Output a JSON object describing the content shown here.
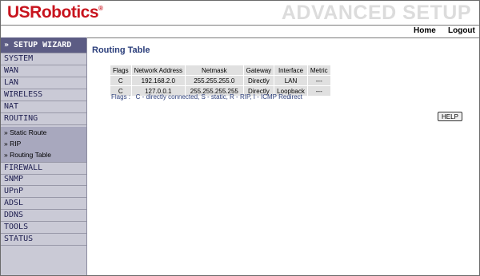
{
  "brand": {
    "logo_text": "USRobotics",
    "reg_mark": "®",
    "banner": "ADVANCED SETUP"
  },
  "topnav": {
    "home": "Home",
    "logout": "Logout"
  },
  "sidebar": {
    "wizard": "» SETUP WIZARD",
    "items": [
      "SYSTEM",
      "WAN",
      "LAN",
      "WIRELESS",
      "NAT",
      "ROUTING"
    ],
    "routing_sub": [
      "» Static Route",
      "» RIP",
      "» Routing Table"
    ],
    "items_after": [
      "FIREWALL",
      "SNMP",
      "UPnP",
      "ADSL",
      "DDNS",
      "TOOLS",
      "STATUS"
    ]
  },
  "main": {
    "title": "Routing Table",
    "table": {
      "headers": [
        "Flags",
        "Network Address",
        "Netmask",
        "Gateway",
        "Interface",
        "Metric"
      ],
      "rows": [
        [
          "C",
          "192.168.2.0",
          "255.255.255.0",
          "Directly",
          "LAN",
          "---"
        ],
        [
          "C",
          "127.0.0.1",
          "255.255.255.255",
          "Directly",
          "Loopback",
          "---"
        ]
      ]
    },
    "flags_note": "Flags :   C - directly connected, S - static, R - RIP, I - ICMP Redirect",
    "help_label": "HELP"
  },
  "colors": {
    "logo_red": "#c8141e",
    "sidebar_bg": "#cacad6",
    "wizard_bg": "#5c5c84",
    "title_blue": "#2a3d7a"
  }
}
